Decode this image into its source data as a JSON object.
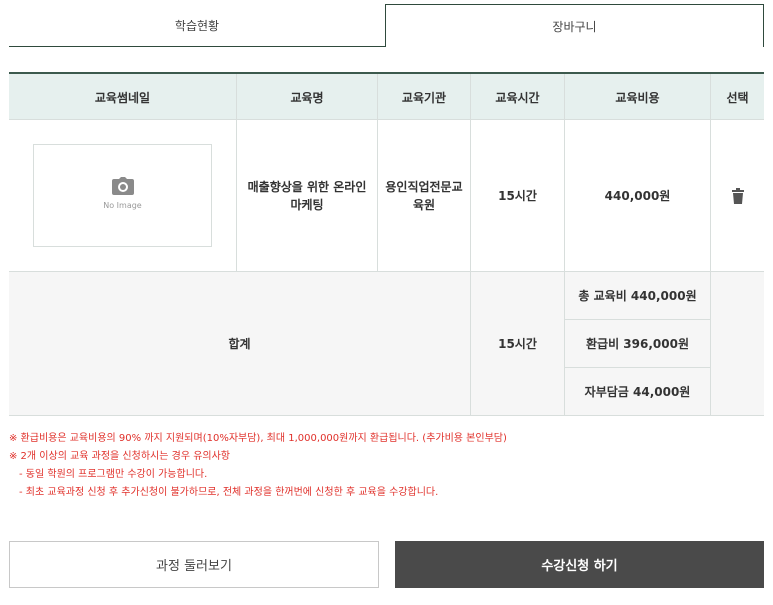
{
  "tabs": [
    {
      "label": "학습현황"
    },
    {
      "label": "장바구니"
    }
  ],
  "table": {
    "headers": [
      "교육썸네일",
      "교육명",
      "교육기관",
      "교육시간",
      "교육비용",
      "선택"
    ],
    "rows": [
      {
        "thumbnail_label": "No Image",
        "course_name": "매출향상을 위한 온라인 마케팅",
        "institution": "용인직업전문교육원",
        "hours": "15시간",
        "cost": "440,000원",
        "action_icon": "trash-icon"
      }
    ],
    "summary": {
      "label": "합계",
      "hours": "15시간",
      "total_cost": "총 교육비 440,000원",
      "refund": "환급비 396,000원",
      "self_pay": "자부담금 44,000원"
    }
  },
  "notes": [
    "※ 환급비용은 교육비용의 90% 까지 지원되며(10%자부담), 최대 1,000,000원까지 환급됩니다. (추가비용 본인부담)",
    "※ 2개 이상의 교육 과정을 신청하시는 경우 유의사항",
    "- 동일 학원의 프로그램만 수강이 가능합니다.",
    "- 최초 교육과정 신청 후 추가신청이 불가하므로, 전체 과정을 한꺼번에 신청한 후 교육을 수강합니다."
  ],
  "buttons": {
    "browse": "과정 둘러보기",
    "apply": "수강신청 하기"
  },
  "colors": {
    "accent": "#3c5a4d",
    "header_bg": "#e6f0ee",
    "notice": "#e0302a",
    "primary_button": "#4a4a4a"
  }
}
